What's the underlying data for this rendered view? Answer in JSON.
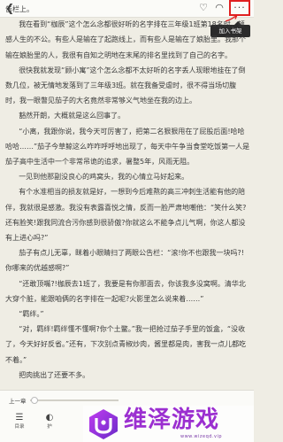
{
  "topbar": {
    "back_icon": "back-chevron-icon",
    "icons": [
      "heart-icon",
      "headphones-icon",
      "more-icon"
    ],
    "more_glyph": "···",
    "highlight_color": "#e02020"
  },
  "popover": {
    "label": "加入书架"
  },
  "content": {
    "paragraphs": [
      "告栏上。",
      "我在看到“枷辰”这个怎么念都很好听的名字排在三年级1班第18名时，顿感人生的不公。有些人是输在了起跑线上，而有些人是输在了娘胎里。我那个输在娘胎里的人，我很有自知之明地在末尾的排名里找到了自己的名字。",
      "很快我就发现“顾小寓”这个怎么念都不太好听的名字丢人现眼地挂在了倒数几位，被无情地发落到了三年级3班。就在我备受虐时，很不得当场切腹时，我一眼瞥见茄子的大名竟然非常够义气地坐在我的边上。",
      "豁然开朗，大概就是这么回事了。",
      "“小离，我跟你说，我今天可厉害了，把第二名狠狠甩在了屁股后面!哈哈哈哈……”茄子今草鲸这么咋咋呼呼地出现了，每天中午争当食堂吃饭第一人是茄子高中生活中一个非常吊诡的追求，暑整5年，风雨无阻。",
      "一见到他那副没良心的鸡窝头，我的心情立马好起来。",
      "有个水准相当的损友就是好，一想到今后难熬的高三冲刺生活能有他的陪伴，我就很是感激。我没有表露喜悦之情，反而一脸严肃地嘲他：“笑什么笑?还有脸笑!跟我同流合污你感到很骄傲?你就这么不能争点儿气啊，你这人都没有上进心吗?”",
      "茄子有点儿无辜，眯着小眼睛扫了两眼公告栏：“滚!你不也跟我一块吗?!你哪来的优越感啊?”",
      "“还敢顶嘴?!枷辰去1班了，我要是有你那面去，你该我多没窝啊。清华北大穿个脏，能跟咱俩的名字排在一起呢?火影里怎么说来着……”",
      "“羁绊。”",
      "“对，羁绊!羁绊懂不懂啊?你个土鳖。”我一把抢过茄子手里的饭盒，“没收了，今天好好反省。”还有，下次别点青椒炒肉，酱里都是肉，害我一点儿都吃不着。”",
      "把肉挑出了还要不多。"
    ]
  },
  "bottom": {
    "prev_label": "上一章",
    "progress": 0.05,
    "toolbar": [
      {
        "label": "目录",
        "icon": "catalog-icon"
      },
      {
        "label": "护",
        "icon": "eye-icon"
      }
    ]
  },
  "watermark": {
    "title": "维泽游戏",
    "url": "www.wizeqd.vip",
    "brand_color": "#9b2fd0"
  }
}
